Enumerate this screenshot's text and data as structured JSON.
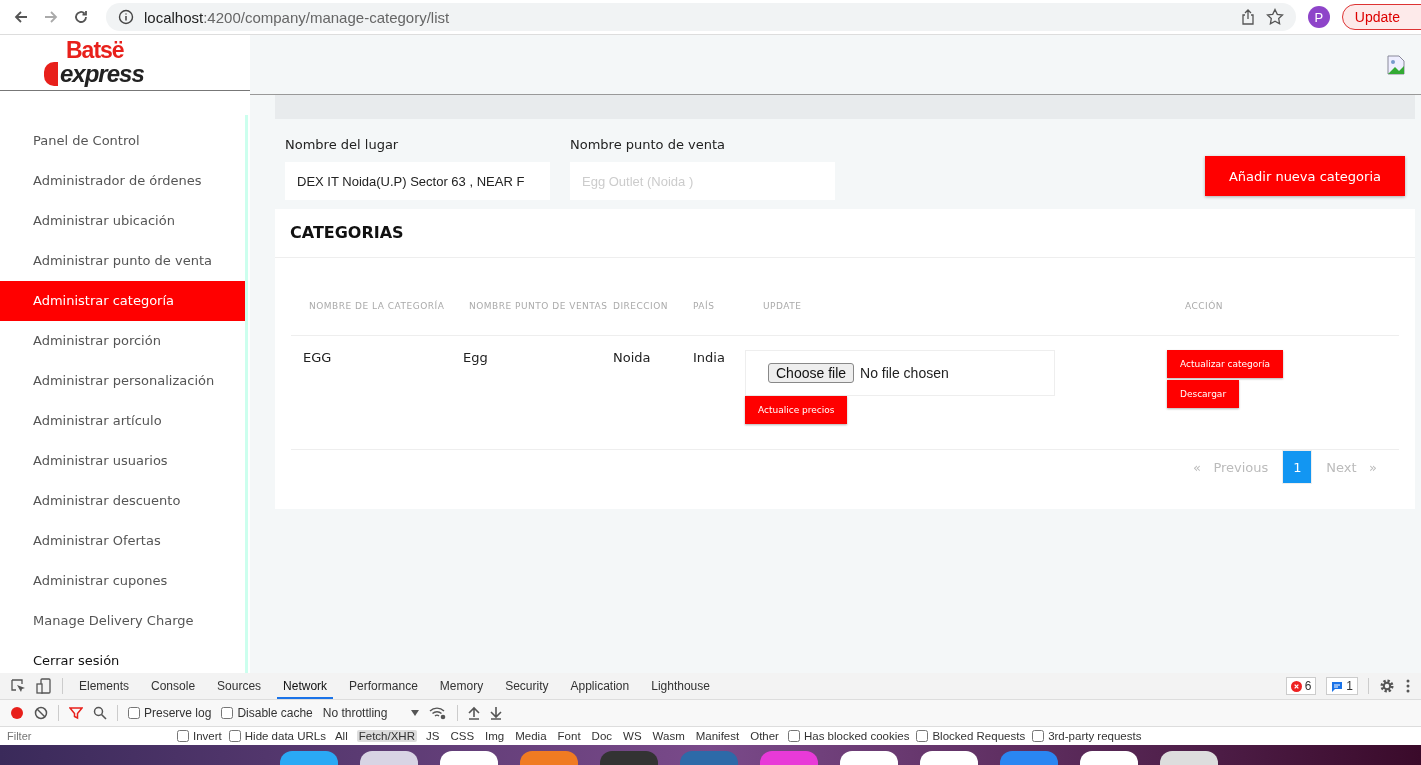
{
  "browser": {
    "url_host": "localhost",
    "url_path": ":4200/company/manage-category/list",
    "profile_initial": "P",
    "update_label": "Update"
  },
  "logo": {
    "top": "Batsë",
    "bottom": "express"
  },
  "sidebar": {
    "items": [
      {
        "label": "Panel de Control",
        "selected": false
      },
      {
        "label": "Administrador de órdenes",
        "selected": false
      },
      {
        "label": "Administrar ubicación",
        "selected": false
      },
      {
        "label": "Administrar punto de venta",
        "selected": false
      },
      {
        "label": "Administrar categoría",
        "selected": true
      },
      {
        "label": "Administrar porción",
        "selected": false
      },
      {
        "label": "Administrar personalización",
        "selected": false
      },
      {
        "label": "Administrar artículo",
        "selected": false
      },
      {
        "label": "Administrar usuarios",
        "selected": false
      },
      {
        "label": "Administrar descuento",
        "selected": false
      },
      {
        "label": "Administrar Ofertas",
        "selected": false
      },
      {
        "label": "Administrar cupones",
        "selected": false
      },
      {
        "label": "Manage Delivery Charge",
        "selected": false
      },
      {
        "label": "Cerrar sesión",
        "selected": false
      }
    ]
  },
  "filters": [
    {
      "label": "Nombre del lugar",
      "value": "DEX IT Noida(U.P) Sector 63 , NEAR F"
    },
    {
      "label": "Nombre punto de venta",
      "placeholder": "Egg Outlet (Noida )"
    }
  ],
  "add_button": "Añadir nueva categoria",
  "card": {
    "title": "CATEGORIAS",
    "columns": [
      "NOMBRE DE LA CATEGORÍA",
      "NOMBRE PUNTO DE VENTAS",
      "DIRECCION",
      "PAÍS",
      "UPDATE",
      "ACCIÓN"
    ],
    "rows": [
      {
        "category": "EGG",
        "outlet": "Egg",
        "address": "Noida",
        "country": "India",
        "file_button": "Choose file",
        "file_status": "No file chosen",
        "update_button": "Actualice precios",
        "actions": [
          "Actualizar categoría",
          "Descargar"
        ]
      }
    ],
    "pagination": {
      "previous": "Previous",
      "next": "Next",
      "prev_mark": "«",
      "next_mark": "»",
      "pages": [
        {
          "label": "1",
          "selected": true
        }
      ]
    }
  },
  "devtools": {
    "tabs": [
      {
        "label": "Elements",
        "selected": false
      },
      {
        "label": "Console",
        "selected": false
      },
      {
        "label": "Sources",
        "selected": false
      },
      {
        "label": "Network",
        "selected": true
      },
      {
        "label": "Performance",
        "selected": false
      },
      {
        "label": "Memory",
        "selected": false
      },
      {
        "label": "Security",
        "selected": false
      },
      {
        "label": "Application",
        "selected": false
      },
      {
        "label": "Lighthouse",
        "selected": false
      }
    ],
    "errors": "6",
    "messages": "1",
    "toolbar": {
      "checks": [
        {
          "label": "Preserve log",
          "checked": false
        },
        {
          "label": "Disable cache",
          "checked": false
        }
      ],
      "throttling": "No throttling"
    },
    "filter_placeholder": "Filter",
    "filter_checks": [
      {
        "label": "Invert",
        "checked": false
      },
      {
        "label": "Hide data URLs",
        "checked": false
      }
    ],
    "types": [
      {
        "label": "All",
        "selected": false
      },
      {
        "label": "Fetch/XHR",
        "selected": true
      },
      {
        "label": "JS",
        "selected": false
      },
      {
        "label": "CSS",
        "selected": false
      },
      {
        "label": "Img",
        "selected": false
      },
      {
        "label": "Media",
        "selected": false
      },
      {
        "label": "Font",
        "selected": false
      },
      {
        "label": "Doc",
        "selected": false
      },
      {
        "label": "WS",
        "selected": false
      },
      {
        "label": "Wasm",
        "selected": false
      },
      {
        "label": "Manifest",
        "selected": false
      },
      {
        "label": "Other",
        "selected": false
      }
    ],
    "extra_checks": [
      {
        "label": "Has blocked cookies",
        "checked": false
      },
      {
        "label": "Blocked Requests",
        "checked": false
      },
      {
        "label": "3rd-party requests",
        "checked": false
      }
    ]
  }
}
